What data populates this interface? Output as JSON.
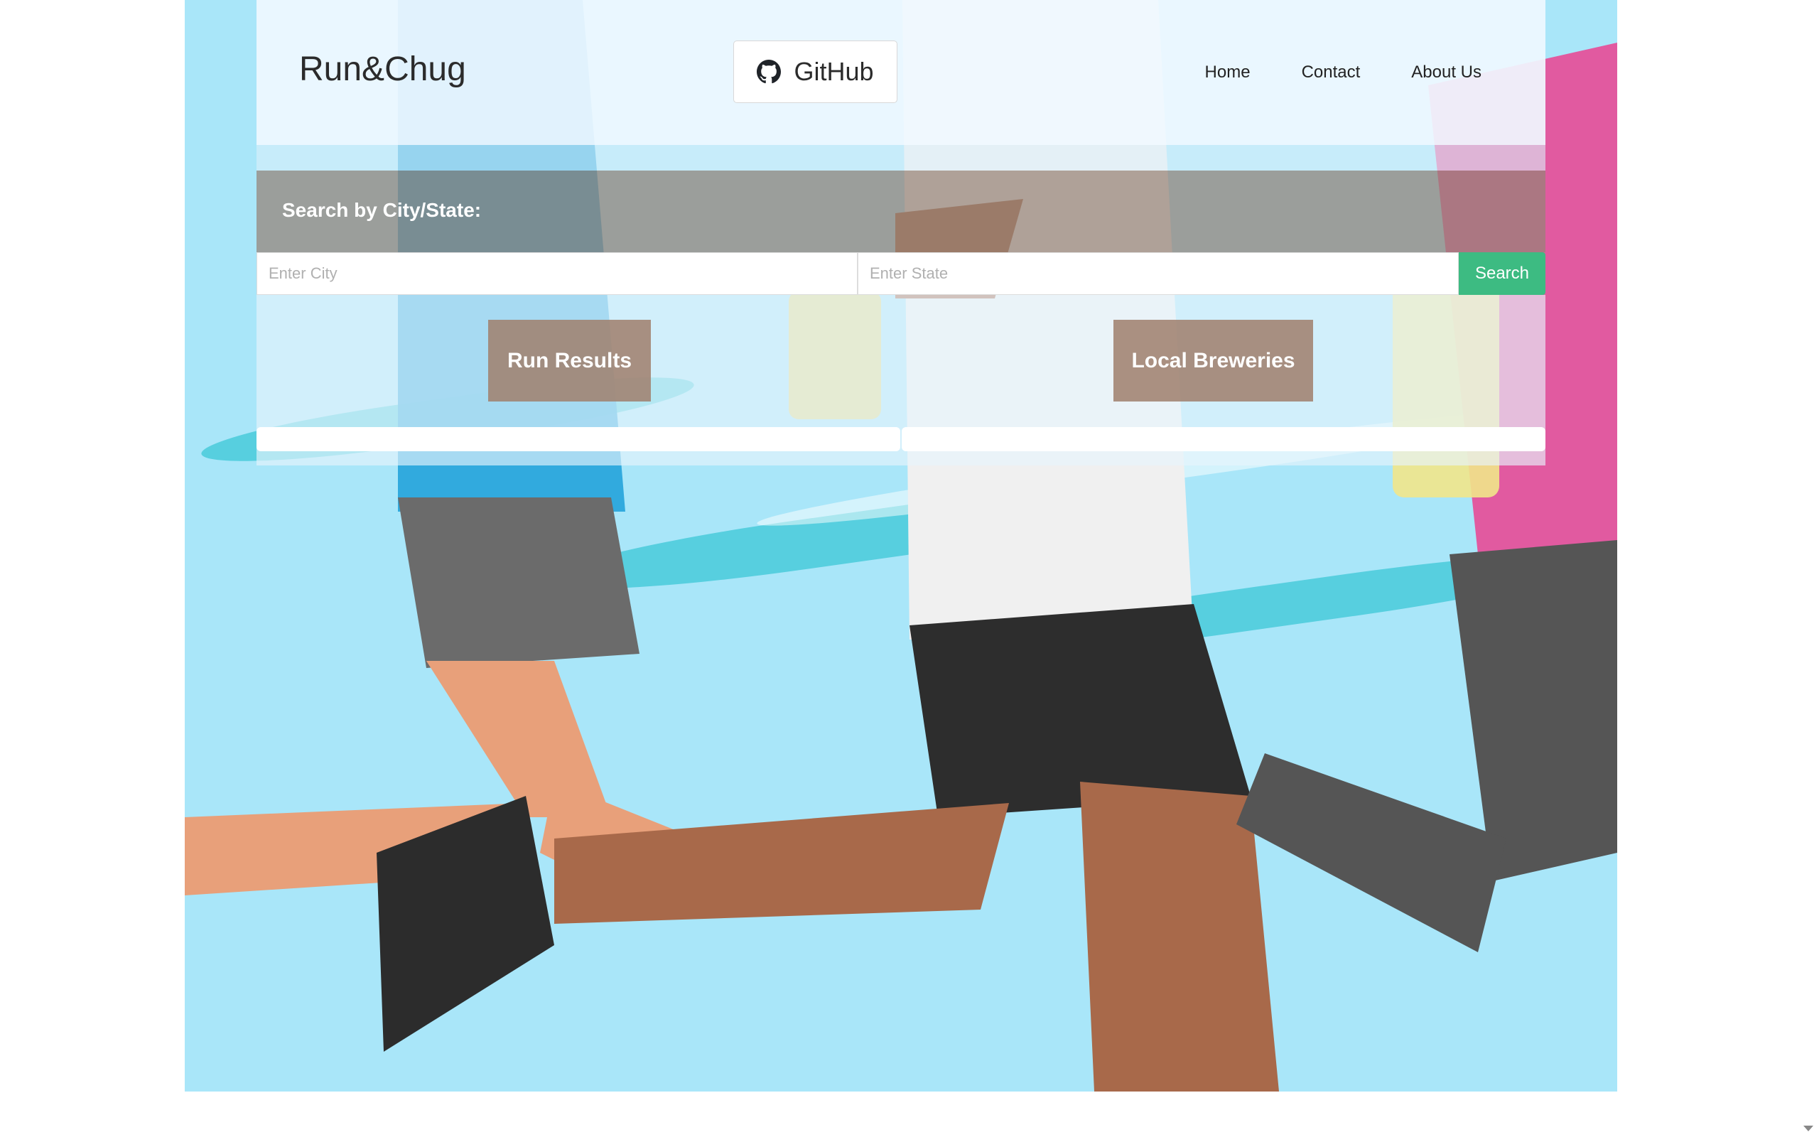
{
  "brand": "Run&Chug",
  "github": {
    "label": "GitHub",
    "icon": "github-icon"
  },
  "nav": [
    "Home",
    "Contact",
    "About Us"
  ],
  "search": {
    "title": "Search by City/State:",
    "city_placeholder": "Enter City",
    "state_placeholder": "Enter State",
    "button_label": "Search"
  },
  "results": {
    "run_label": "Run Results",
    "brewery_label": "Local Breweries"
  },
  "colors": {
    "hero_background": "#a9e6f9",
    "search_button": "#3dbb82",
    "results_button": "#a08270"
  }
}
